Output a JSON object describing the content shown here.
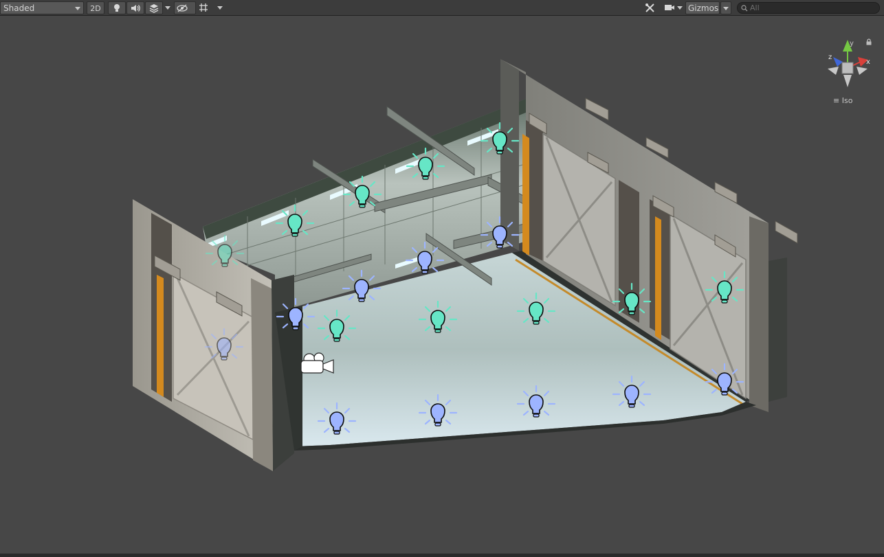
{
  "toolbar": {
    "shading_mode": "Shaded",
    "two_d_label": "2D",
    "hidden_count": "0",
    "gizmos_label": "Gizmos",
    "search_placeholder": "All"
  },
  "orientation": {
    "projection_label": "Iso",
    "axis_x": "x",
    "axis_y": "y",
    "axis_z": "z"
  },
  "colors": {
    "point_light": "#66e6c6",
    "spot_light": "#9db4ff",
    "toolbar_bg": "#3c3c3c",
    "viewport_bg": "#474747"
  },
  "icons": [
    "lightbulb-icon",
    "audio-icon",
    "effects-icon",
    "visibility-icon",
    "grid-icon",
    "tools-icon",
    "camera-icon",
    "search-icon",
    "lock-icon"
  ]
}
